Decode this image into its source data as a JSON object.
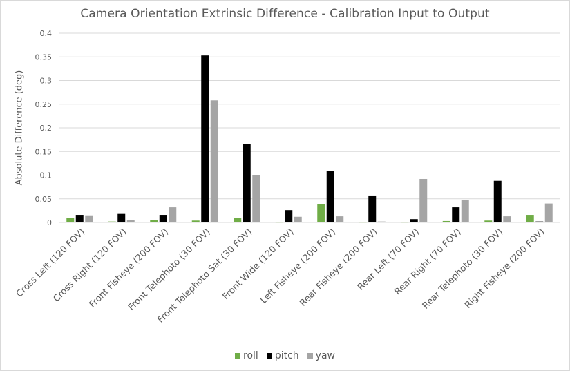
{
  "chart_data": {
    "type": "bar",
    "title": "Camera Orientation Extrinsic Difference - Calibration Input to Output",
    "xlabel": "",
    "ylabel": "Absolute Difference (deg)",
    "ylim": [
      0,
      0.4
    ],
    "yticks": [
      "0",
      "0.05",
      "0.1",
      "0.15",
      "0.2",
      "0.25",
      "0.3",
      "0.35",
      "0.4"
    ],
    "ytick_values": [
      0,
      0.05,
      0.1,
      0.15,
      0.2,
      0.25,
      0.3,
      0.35,
      0.4
    ],
    "grid": true,
    "legend_position": "bottom",
    "categories": [
      "Cross Left (120 FOV)",
      "Cross Right (120 FOV)",
      "Front Fisheye (200 FOV)",
      "Front Telephoto (30 FOV)",
      "Front Telephoto Sat (30 FOV)",
      "Front Wide (120 FOV)",
      "Left Fisheye (200 FOV)",
      "Rear Fisheye (200 FOV)",
      "Rear Left (70 FOV)",
      "Rear Right (70 FOV)",
      "Rear Telephoto (30 FOV)",
      "Right Fisheye (200 FOV)"
    ],
    "series": [
      {
        "name": "roll",
        "color": "#70ad47",
        "values": [
          0.009,
          0.002,
          0.005,
          0.004,
          0.01,
          0.001,
          0.038,
          0.001,
          0.001,
          0.003,
          0.004,
          0.016
        ]
      },
      {
        "name": "pitch",
        "color": "#000000",
        "values": [
          0.016,
          0.018,
          0.016,
          0.353,
          0.165,
          0.026,
          0.109,
          0.057,
          0.007,
          0.032,
          0.088,
          0.002
        ]
      },
      {
        "name": "yaw",
        "color": "#a5a5a5",
        "values": [
          0.015,
          0.005,
          0.032,
          0.258,
          0.1,
          0.012,
          0.013,
          0.002,
          0.092,
          0.048,
          0.013,
          0.04
        ]
      }
    ]
  }
}
